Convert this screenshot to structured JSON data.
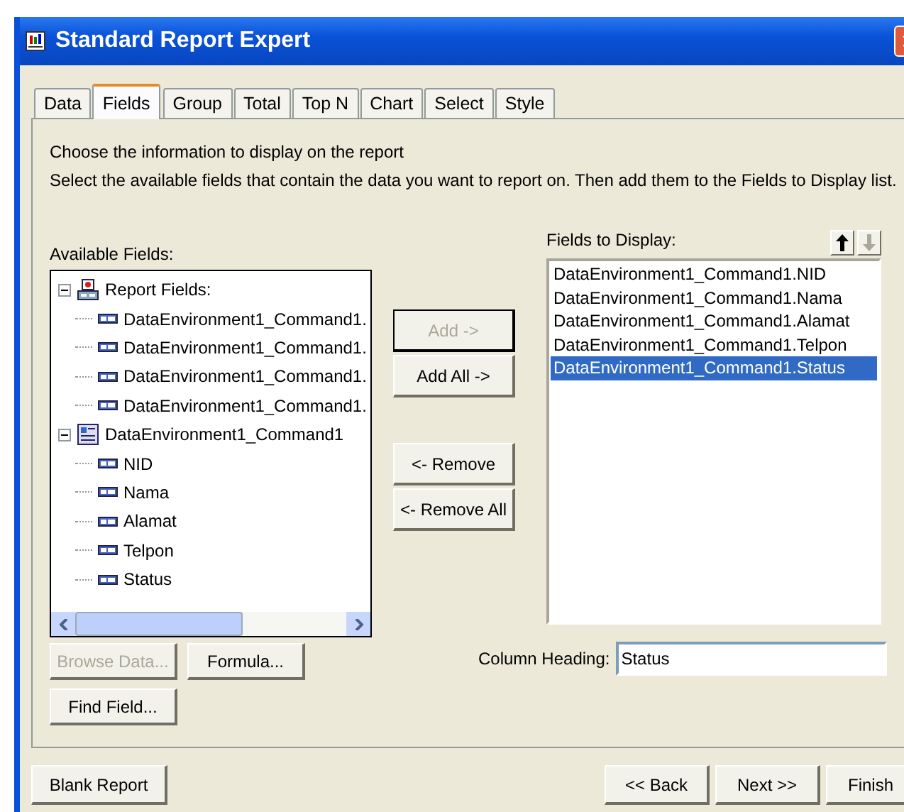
{
  "window": {
    "title": "Standard Report Expert"
  },
  "tabs": [
    {
      "label": "Data",
      "selected": false
    },
    {
      "label": "Fields",
      "selected": true
    },
    {
      "label": "Group",
      "selected": false
    },
    {
      "label": "Total",
      "selected": false
    },
    {
      "label": "Top N",
      "selected": false
    },
    {
      "label": "Chart",
      "selected": false
    },
    {
      "label": "Select",
      "selected": false
    },
    {
      "label": "Style",
      "selected": false
    }
  ],
  "instructions": [
    "Choose the information to display on the report",
    "Select the available fields that contain the data you want to report on.  Then add them to the Fields to Display list."
  ],
  "available_fields": {
    "label": "Available Fields:",
    "tree": [
      {
        "label": "Report Fields:",
        "kind": "report",
        "expanded": true,
        "children": [
          {
            "label": "DataEnvironment1_Command1.",
            "kind": "field"
          },
          {
            "label": "DataEnvironment1_Command1.",
            "kind": "field"
          },
          {
            "label": "DataEnvironment1_Command1.",
            "kind": "field"
          },
          {
            "label": "DataEnvironment1_Command1.",
            "kind": "field"
          }
        ]
      },
      {
        "label": "DataEnvironment1_Command1",
        "kind": "command",
        "expanded": true,
        "children": [
          {
            "label": "NID",
            "kind": "field"
          },
          {
            "label": "Nama",
            "kind": "field"
          },
          {
            "label": "Alamat",
            "kind": "field"
          },
          {
            "label": "Telpon",
            "kind": "field"
          },
          {
            "label": "Status",
            "kind": "field"
          }
        ]
      }
    ]
  },
  "move_buttons": [
    {
      "label": "Add ->",
      "disabled": true
    },
    {
      "label": "Add All ->",
      "disabled": false
    },
    {
      "label": "<- Remove",
      "disabled": false
    },
    {
      "label": "<- Remove All",
      "disabled": false
    }
  ],
  "fields_to_display": {
    "label": "Fields to Display:",
    "items": [
      {
        "label": "DataEnvironment1_Command1.NID",
        "selected": false
      },
      {
        "label": "DataEnvironment1_Command1.Nama",
        "selected": false
      },
      {
        "label": "DataEnvironment1_Command1.Alamat",
        "selected": false
      },
      {
        "label": "DataEnvironment1_Command1.Telpon",
        "selected": false
      },
      {
        "label": "DataEnvironment1_Command1.Status",
        "selected": true
      }
    ],
    "move_up_disabled": false,
    "move_down_disabled": true
  },
  "field_buttons": [
    {
      "label": "Browse Data...",
      "disabled": true
    },
    {
      "label": "Formula...",
      "disabled": false
    },
    {
      "label": "Find Field...",
      "disabled": false
    }
  ],
  "column_heading": {
    "label": "Column Heading:",
    "value": "Status"
  },
  "footer_buttons": [
    {
      "label": "Blank Report"
    },
    {
      "label": "<< Back"
    },
    {
      "label": "Next >>"
    },
    {
      "label": "Finish"
    }
  ]
}
